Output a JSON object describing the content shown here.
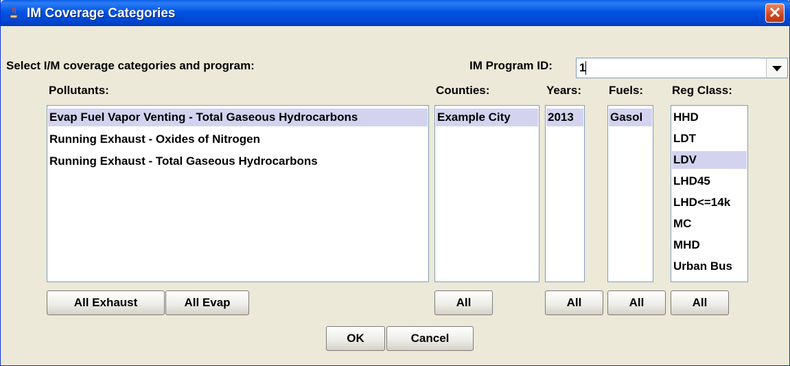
{
  "window": {
    "title": "IM Coverage Categories",
    "close_label": "✕"
  },
  "header": {
    "prompt": "Select I/M coverage categories and program:",
    "program_id_label": "IM Program ID:",
    "program_id_value": "1"
  },
  "columns": {
    "pollutants": "Pollutants:",
    "counties": "Counties:",
    "years": "Years:",
    "fuels": "Fuels:",
    "reg_class": "Reg Class:"
  },
  "lists": {
    "pollutants": [
      {
        "label": "Evap Fuel Vapor Venting - Total Gaseous Hydrocarbons",
        "selected": true
      },
      {
        "label": "Running Exhaust - Oxides of Nitrogen",
        "selected": false
      },
      {
        "label": "Running Exhaust - Total Gaseous Hydrocarbons",
        "selected": false
      }
    ],
    "counties": [
      {
        "label": "Example City",
        "selected": true
      }
    ],
    "years": [
      {
        "label": "2013",
        "selected": true
      }
    ],
    "fuels": [
      {
        "label": "Gasol",
        "selected": true
      }
    ],
    "reg_class": [
      {
        "label": "HHD",
        "selected": false
      },
      {
        "label": "LDT",
        "selected": false
      },
      {
        "label": "LDV",
        "selected": true
      },
      {
        "label": "LHD45",
        "selected": false
      },
      {
        "label": "LHD<=14k",
        "selected": false
      },
      {
        "label": "MC",
        "selected": false
      },
      {
        "label": "MHD",
        "selected": false
      },
      {
        "label": "Urban Bus",
        "selected": false
      }
    ]
  },
  "buttons": {
    "all_exhaust": "All Exhaust",
    "all_evap": "All Evap",
    "all": "All",
    "ok": "OK",
    "cancel": "Cancel"
  }
}
